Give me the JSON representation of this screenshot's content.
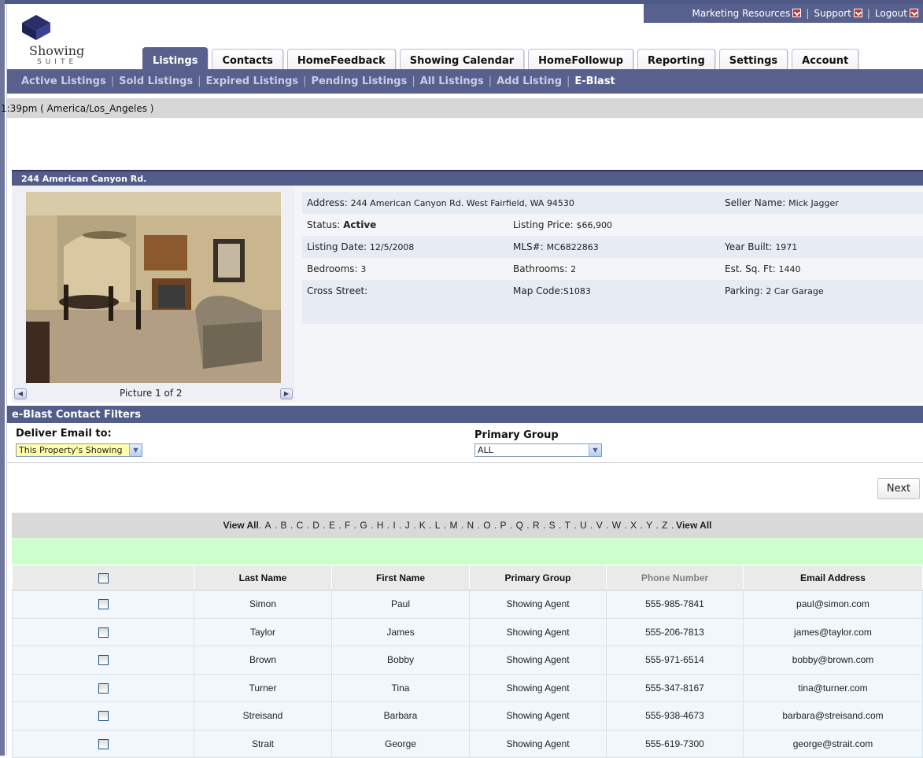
{
  "top_links": [
    {
      "label": "Marketing Resources"
    },
    {
      "label": "Support"
    },
    {
      "label": "Logout"
    }
  ],
  "logo": {
    "line1": "Showing",
    "line2": "SUITE"
  },
  "tabs": [
    {
      "label": "Listings",
      "active": true
    },
    {
      "label": "Contacts"
    },
    {
      "label": "HomeFeedback"
    },
    {
      "label": "Showing Calendar"
    },
    {
      "label": "HomeFollowup"
    },
    {
      "label": "Reporting"
    },
    {
      "label": "Settings"
    },
    {
      "label": "Account"
    }
  ],
  "subnav": [
    {
      "label": "Active Listings"
    },
    {
      "label": "Sold Listings"
    },
    {
      "label": "Expired Listings"
    },
    {
      "label": "Pending Listings"
    },
    {
      "label": "All Listings"
    },
    {
      "label": "Add Listing"
    },
    {
      "label": "E-Blast",
      "current": true
    }
  ],
  "time_text": "1:39pm ( America/Los_Angeles )",
  "property": {
    "title": "244 American Canyon Rd.",
    "picture_label": "Picture 1 of 2",
    "address_label": "Address:",
    "address_value": "244 American Canyon Rd.  West Fairfield,  WA  94530",
    "seller_label": "Seller Name:",
    "seller_value": "Mick Jagger",
    "status_label": "Status:",
    "status_value": "Active",
    "price_label": "Listing Price:",
    "price_value": "$66,900",
    "listing_date_label": "Listing Date:",
    "listing_date_value": "12/5/2008",
    "mls_label": "MLS#:",
    "mls_value": "MC6822863",
    "year_built_label": "Year Built:",
    "year_built_value": "1971",
    "bedrooms_label": "Bedrooms:",
    "bedrooms_value": "3",
    "bathrooms_label": "Bathrooms:",
    "bathrooms_value": "2",
    "sqft_label": "Est. Sq. Ft:",
    "sqft_value": "1440",
    "cross_street_label": "Cross Street:",
    "map_code_label": "Map Code:",
    "map_code_value": "S1083",
    "parking_label": "Parking:",
    "parking_value": "2 Car Garage"
  },
  "filters": {
    "title": "e-Blast Contact Filters",
    "deliver_label": "Deliver Email to:",
    "deliver_value": "This Property's Showing",
    "group_label": "Primary Group",
    "group_value": "ALL"
  },
  "next_label": "Next",
  "alpha": {
    "view_all": "View All",
    "letters": [
      "A",
      "B",
      "C",
      "D",
      "E",
      "F",
      "G",
      "H",
      "I",
      "J",
      "K",
      "L",
      "M",
      "N",
      "O",
      "P",
      "Q",
      "R",
      "S",
      "T",
      "U",
      "V",
      "W",
      "X",
      "Y",
      "Z"
    ]
  },
  "table": {
    "headers": [
      "Last Name",
      "First Name",
      "Primary Group",
      "Phone Number",
      "Email Address"
    ],
    "rows": [
      [
        "Simon",
        "Paul",
        "Showing Agent",
        "555-985-7841",
        "paul@simon.com"
      ],
      [
        "Taylor",
        "James",
        "Showing Agent",
        "555-206-7813",
        "james@taylor.com"
      ],
      [
        "Brown",
        "Bobby",
        "Showing Agent",
        "555-971-6514",
        "bobby@brown.com"
      ],
      [
        "Turner",
        "Tina",
        "Showing Agent",
        "555-347-8167",
        "tina@turner.com"
      ],
      [
        "Streisand",
        "Barbara",
        "Showing Agent",
        "555-938-4673",
        "barbara@streisand.com"
      ],
      [
        "Strait",
        "George",
        "Showing Agent",
        "555-619-7300",
        "george@strait.com"
      ]
    ]
  },
  "colors": {
    "nav_bg": "#58618e",
    "green_bar": "#ccffcc",
    "time_bar": "#d7d7d7"
  }
}
